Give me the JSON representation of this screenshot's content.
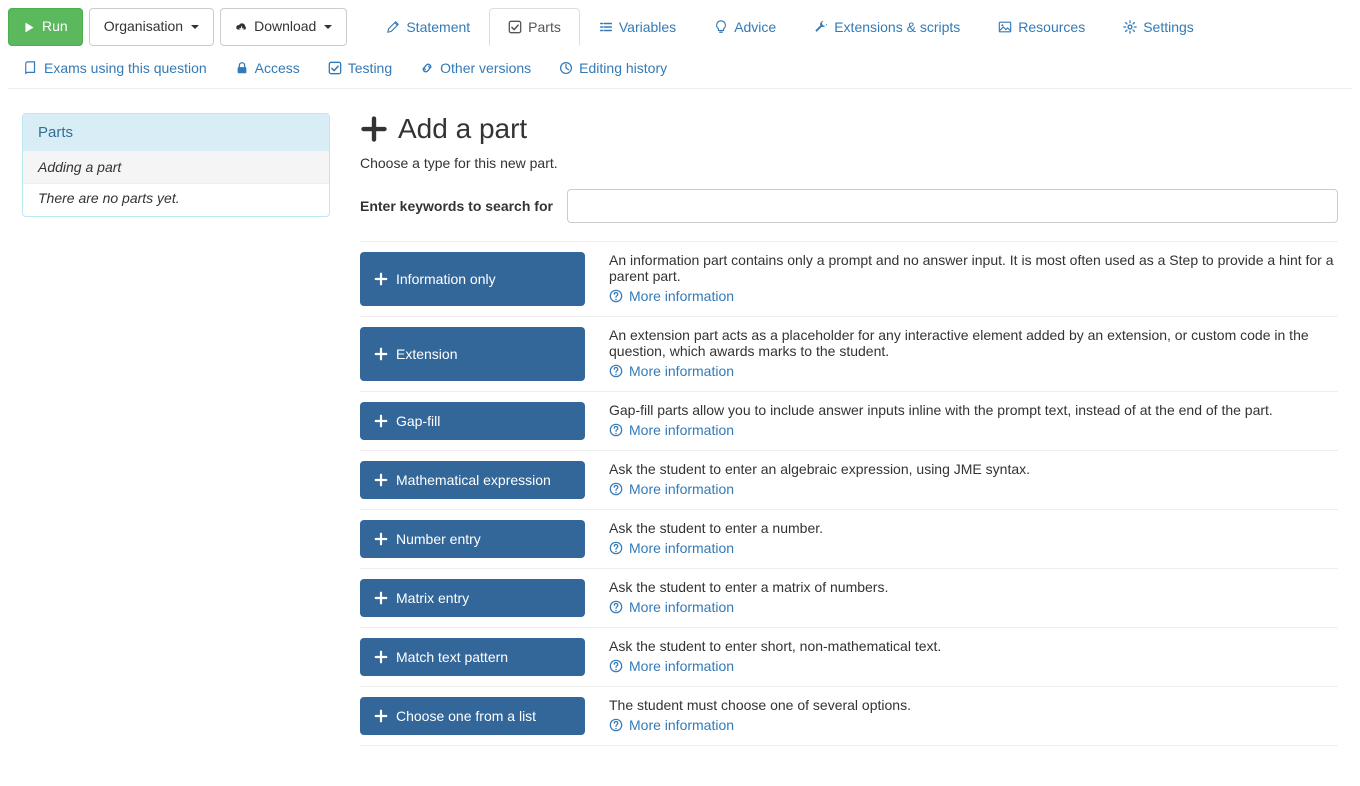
{
  "toolbar": {
    "run_label": "Run",
    "organisation_label": "Organisation",
    "download_label": "Download"
  },
  "tabs": {
    "statement": "Statement",
    "parts": "Parts",
    "variables": "Variables",
    "advice": "Advice",
    "extensions": "Extensions & scripts",
    "resources": "Resources",
    "settings": "Settings"
  },
  "secondary_nav": {
    "exams": "Exams using this question",
    "access": "Access",
    "testing": "Testing",
    "other_versions": "Other versions",
    "editing_history": "Editing history"
  },
  "sidebar": {
    "heading": "Parts",
    "adding": "Adding a part",
    "empty": "There are no parts yet."
  },
  "addpart": {
    "title": "Add a part",
    "subtitle": "Choose a type for this new part.",
    "search_label": "Enter keywords to search for",
    "more_info": "More information"
  },
  "parttypes": [
    {
      "label": "Information only",
      "desc": "An information part contains only a prompt and no answer input. It is most often used as a Step to provide a hint for a parent part."
    },
    {
      "label": "Extension",
      "desc": "An extension part acts as a placeholder for any interactive element added by an extension, or custom code in the question, which awards marks to the student."
    },
    {
      "label": "Gap-fill",
      "desc": "Gap-fill parts allow you to include answer inputs inline with the prompt text, instead of at the end of the part."
    },
    {
      "label": "Mathematical expression",
      "desc": "Ask the student to enter an algebraic expression, using JME syntax."
    },
    {
      "label": "Number entry",
      "desc": "Ask the student to enter a number."
    },
    {
      "label": "Matrix entry",
      "desc": "Ask the student to enter a matrix of numbers."
    },
    {
      "label": "Match text pattern",
      "desc": "Ask the student to enter short, non-mathematical text."
    },
    {
      "label": "Choose one from a list",
      "desc": "The student must choose one of several options."
    }
  ]
}
